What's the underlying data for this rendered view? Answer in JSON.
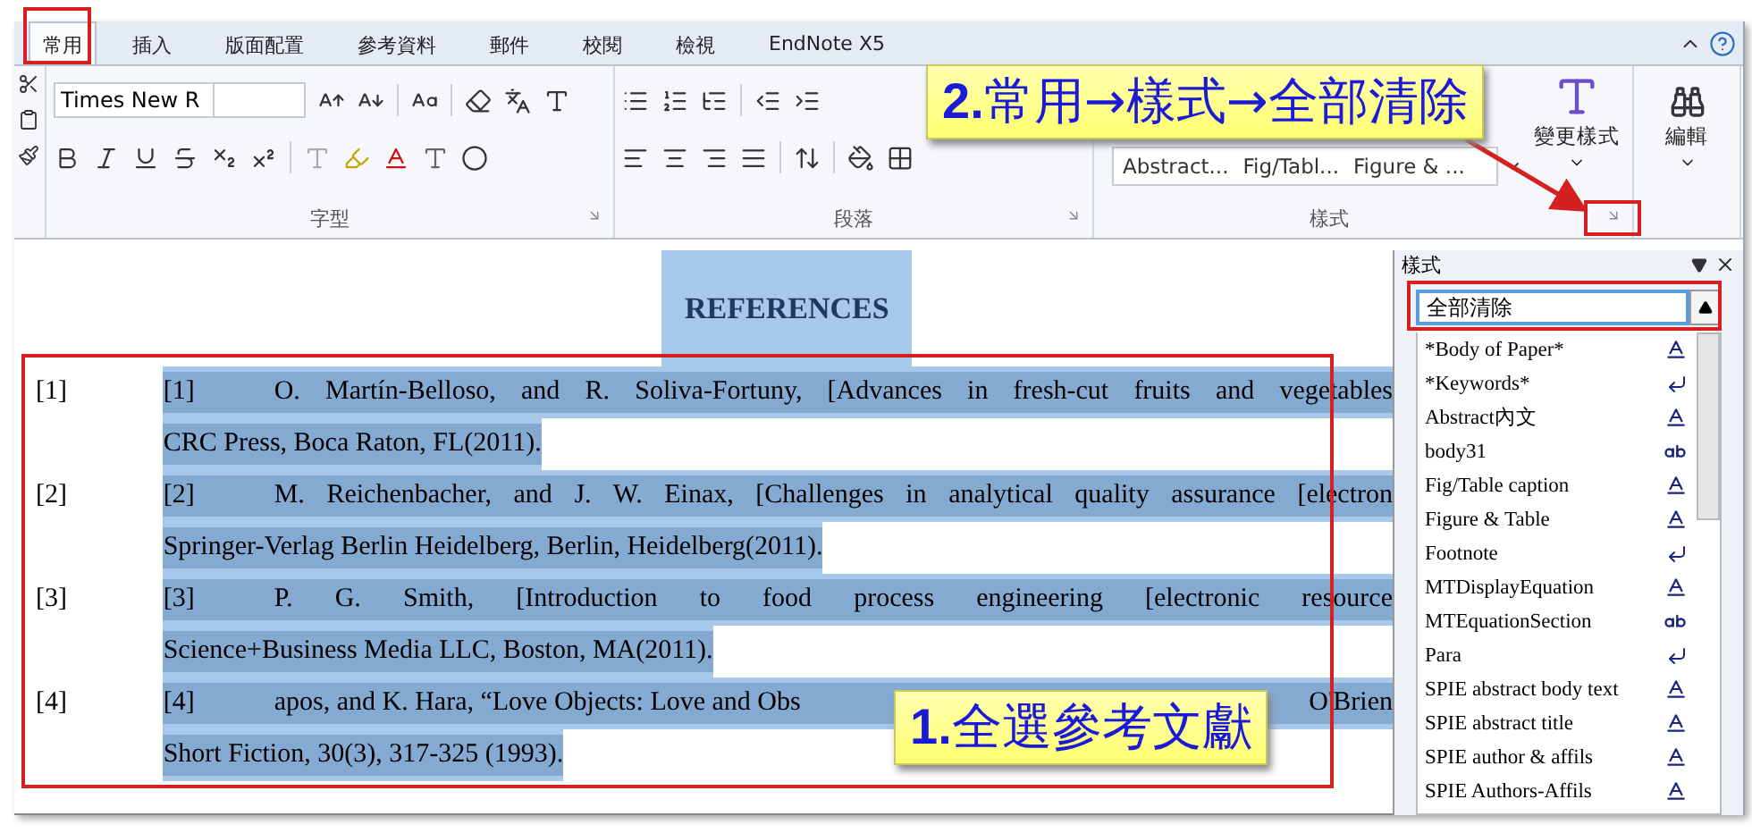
{
  "tabs": [
    {
      "label": "常用",
      "selected": true
    },
    {
      "label": "插入",
      "selected": false
    },
    {
      "label": "版面配置",
      "selected": false
    },
    {
      "label": "參考資料",
      "selected": false
    },
    {
      "label": "郵件",
      "selected": false
    },
    {
      "label": "校閱",
      "selected": false
    },
    {
      "label": "檢視",
      "selected": false
    },
    {
      "label": "EndNote X5",
      "selected": false
    }
  ],
  "ribbon": {
    "font_name": "Times New R",
    "groups": [
      {
        "label": "字型"
      },
      {
        "label": "段落"
      },
      {
        "label": "樣式"
      }
    ],
    "style_gallery": [
      "Abstract...",
      "Fig/Tabl...",
      "Figure & ..."
    ],
    "change_styles": "變更樣式",
    "editing": "編輯"
  },
  "document": {
    "heading": "REFERENCES",
    "references": [
      {
        "marker": "[1]",
        "number": "[1]",
        "first_line": [
          "O. Martín-Belloso, and R. Soliva-Fortuny, [Advances in fresh-cut fruits and vegetables"
        ],
        "last_line": "CRC Press, Boca Raton, FL(2011)."
      },
      {
        "marker": "[2]",
        "number": "[2]",
        "first_line": [
          "M. Reichenbacher, and J. W. Einax, [Challenges in analytical quality assurance [electron"
        ],
        "last_line": "Springer-Verlag Berlin Heidelberg, Berlin, Heidelberg(2011)."
      },
      {
        "marker": "[3]",
        "number": "[3]",
        "first_line": [
          "P. G. Smith, [Introduction to food process engineering [electronic resource"
        ],
        "last_line": "Science+Business Media LLC, Boston, MA(2011)."
      },
      {
        "marker": "[4]",
        "number": "[4]",
        "first_line": [
          "apos, and K. Hara, “Love Objects: Love and Obs",
          "O'Brien"
        ],
        "last_line": "Short Fiction, 30(3), 317-325 (1993)."
      }
    ]
  },
  "styles_pane": {
    "title": "樣式",
    "current": "全部清除",
    "items": [
      {
        "name": "*Body of Paper*",
        "kind": "linked"
      },
      {
        "name": "*Keywords*",
        "kind": "paragraph"
      },
      {
        "name": "Abstract內文",
        "kind": "linked"
      },
      {
        "name": "body31",
        "kind": "character"
      },
      {
        "name": "Fig/Table caption",
        "kind": "linked"
      },
      {
        "name": "Figure & Table",
        "kind": "linked"
      },
      {
        "name": "Footnote",
        "kind": "paragraph"
      },
      {
        "name": "MTDisplayEquation",
        "kind": "linked"
      },
      {
        "name": "MTEquationSection",
        "kind": "character"
      },
      {
        "name": "Para",
        "kind": "paragraph"
      },
      {
        "name": "SPIE abstract body text",
        "kind": "linked"
      },
      {
        "name": "SPIE abstract title",
        "kind": "linked"
      },
      {
        "name": "SPIE author & affils",
        "kind": "linked"
      },
      {
        "name": "SPIE Authors-Affils",
        "kind": "linked"
      }
    ]
  },
  "callouts": [
    {
      "text": "**2.**常用→樣式→全部清除"
    },
    {
      "text": "**1.**全選參考文獻"
    }
  ]
}
